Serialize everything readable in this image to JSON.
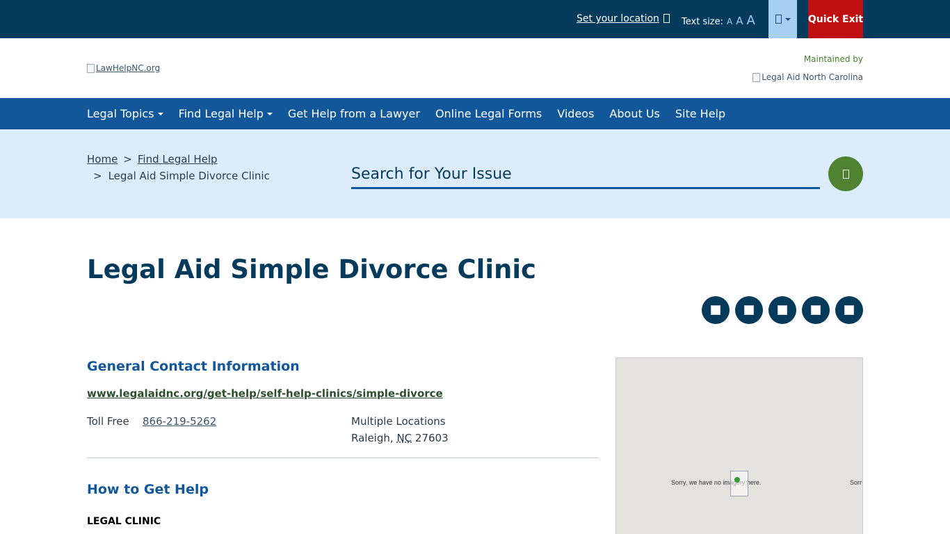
{
  "topbar": {
    "set_location": "Set your location",
    "text_size_label": "Text size:",
    "text_size_options": [
      "A",
      "A",
      "A"
    ],
    "quick_exit": "Quick Exit"
  },
  "header": {
    "logo_alt": "LawHelpNC.org",
    "maintained_by": "Maintained by",
    "partner_logo_alt": "Legal Aid North Carolina"
  },
  "nav": {
    "items": [
      {
        "label": "Legal Topics",
        "has_menu": true
      },
      {
        "label": "Find Legal Help",
        "has_menu": true
      },
      {
        "label": "Get Help from a Lawyer",
        "has_menu": false
      },
      {
        "label": "Online Legal Forms",
        "has_menu": false
      },
      {
        "label": "Videos",
        "has_menu": false
      },
      {
        "label": "About Us",
        "has_menu": false
      },
      {
        "label": "Site Help",
        "has_menu": false
      }
    ]
  },
  "breadcrumb": {
    "home": "Home",
    "separator": ">",
    "parent": "Find Legal Help",
    "current": "Legal Aid Simple Divorce Clinic"
  },
  "search": {
    "placeholder": "Search for Your Issue",
    "value": ""
  },
  "page": {
    "title": "Legal Aid Simple Divorce Clinic"
  },
  "contact": {
    "heading": "General Contact Information",
    "website": "www.legalaidnc.org/get-help/self-help-clinics/simple-divorce",
    "toll_free_label": "Toll Free",
    "toll_free_number": "866-219-5262",
    "address_line1": "Multiple Locations",
    "city": "Raleigh",
    "state": "NC",
    "zip": "27603"
  },
  "howto": {
    "heading": "How to Get Help",
    "type": "LEGAL CLINIC"
  },
  "map": {
    "no_imagery_text": "Sorry, we have no imagery here.",
    "no_imagery_text_cut": "Sorr"
  },
  "colors": {
    "topbar": "#043b5c",
    "nav": "#11579a",
    "search_band": "#dcecfb",
    "quick_exit": "#bf0f0f",
    "search_button": "#4e8331",
    "title": "#043b5c",
    "heading": "#11579a"
  },
  "icons": {
    "location": "map-marker-icon",
    "language": "language-icon",
    "search": "search-icon",
    "share": [
      "share-icon",
      "share-icon",
      "share-icon",
      "share-icon",
      "share-icon"
    ]
  }
}
